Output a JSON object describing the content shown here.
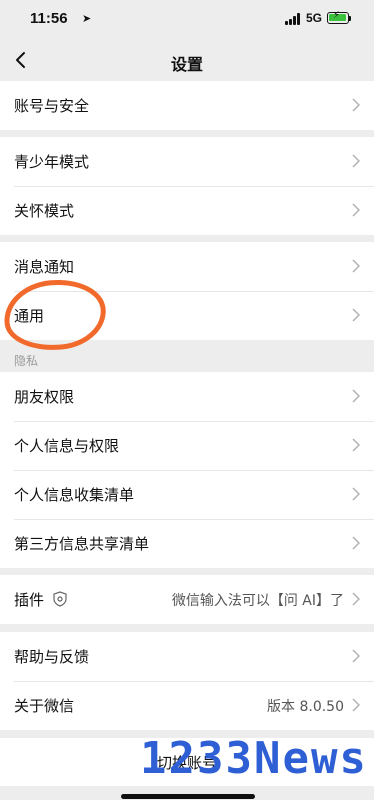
{
  "status": {
    "time": "11:56",
    "network": "5G"
  },
  "nav": {
    "title": "设置"
  },
  "groups": {
    "account": [
      "账号与安全"
    ],
    "modes": [
      "青少年模式",
      "关怀模式"
    ],
    "general": [
      "消息通知",
      "通用"
    ],
    "privacy_header": "隐私",
    "privacy": [
      "朋友权限",
      "个人信息与权限",
      "个人信息收集清单",
      "第三方信息共享清单"
    ],
    "plugins": {
      "label": "插件",
      "value": "微信输入法可以【问 AI】了"
    },
    "about": {
      "help": "帮助与反馈",
      "about": "关于微信",
      "version": "版本 8.0.50"
    },
    "switch_account": "切换账号"
  },
  "watermark": "1233News",
  "colors": {
    "accent_circle": "#f16a2b",
    "watermark": "#2f5fd4",
    "battery": "#3cc13c"
  }
}
